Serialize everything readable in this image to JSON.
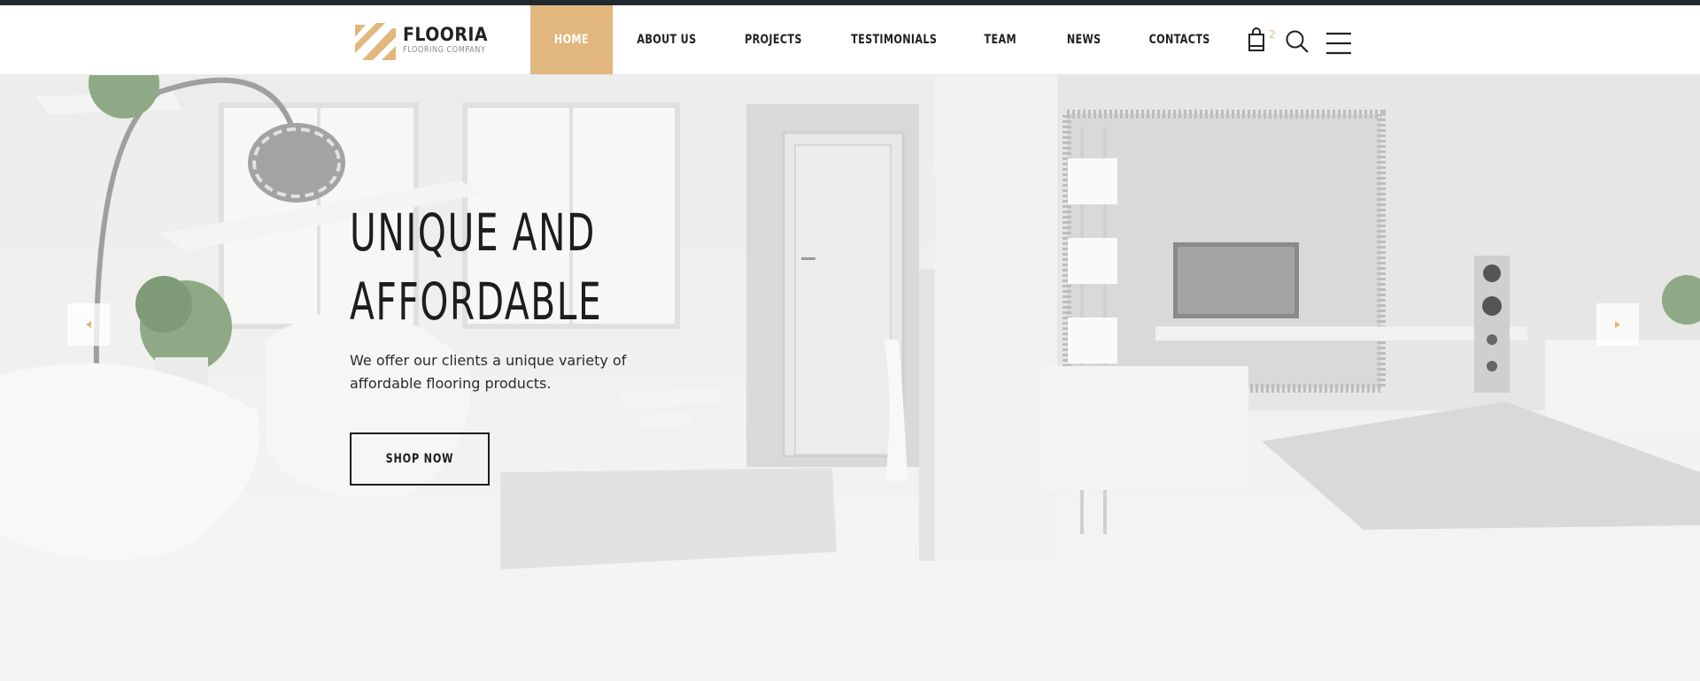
{
  "brand": {
    "name": "FLOORIA",
    "tagline": "FLOORING COMPANY",
    "accent_color": "#e1b77d",
    "logo_icon": "floor-tiles-logo-icon"
  },
  "nav": {
    "items": [
      {
        "label": "HOME",
        "active": true
      },
      {
        "label": "ABOUT US",
        "active": false
      },
      {
        "label": "PROJECTS",
        "active": false
      },
      {
        "label": "TESTIMONIALS",
        "active": false
      },
      {
        "label": "TEAM",
        "active": false
      },
      {
        "label": "NEWS",
        "active": false
      },
      {
        "label": "CONTACTS",
        "active": false
      }
    ]
  },
  "header_icons": {
    "cart_icon": "shopping-bag-icon",
    "cart_count": "2",
    "search_icon": "search-icon",
    "menu_icon": "hamburger-menu-icon"
  },
  "hero": {
    "title_line1": "UNIQUE AND",
    "title_line2": "AFFORDABLE",
    "text": "We offer our clients a unique variety of affordable flooring products.",
    "button_label": "SHOP NOW",
    "prev_icon": "arrow-left-icon",
    "next_icon": "arrow-right-icon"
  }
}
